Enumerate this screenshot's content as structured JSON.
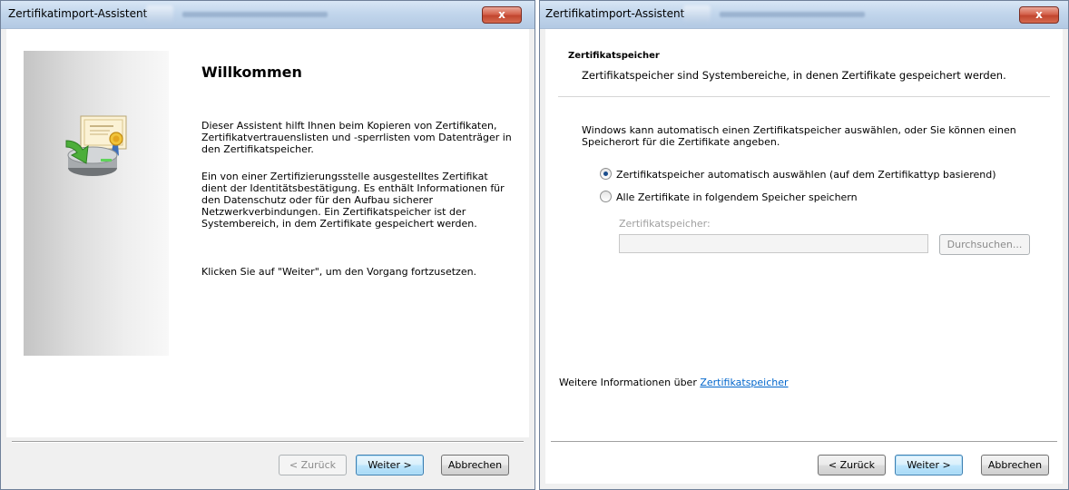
{
  "wizard_intro": {
    "title": "Zertifikatimport-Assistent",
    "close_glyph": "x",
    "heading": "Willkommen",
    "paragraph1": "Dieser Assistent hilft Ihnen beim Kopieren von Zertifikaten, Zertifikatvertrauenslisten und -sperrlisten vom Datenträger in den Zertifikatspeicher.",
    "paragraph2": "Ein von einer Zertifizierungsstelle ausgestelltes Zertifikat dient der Identitätsbestätigung. Es enthält Informationen für den Datenschutz oder für den Aufbau sicherer Netzwerkverbindungen. Ein Zertifikatspeicher ist der Systembereich, in dem Zertifikate gespeichert werden.",
    "paragraph3": "Klicken Sie auf \"Weiter\", um den Vorgang fortzusetzen.",
    "icon": "certificate-import-icon",
    "buttons": {
      "back": "< Zurück",
      "next": "Weiter >",
      "cancel": "Abbrechen"
    }
  },
  "wizard_store": {
    "title": "Zertifikatimport-Assistent",
    "close_glyph": "x",
    "section_title": "Zertifikatspeicher",
    "section_subtitle": "Zertifikatspeicher sind Systembereiche, in denen Zertifikate gespeichert werden.",
    "description": "Windows kann automatisch einen Zertifikatspeicher auswählen, oder Sie können einen Speicherort für die Zertifikate angeben.",
    "options": [
      {
        "label": "Zertifikatspeicher automatisch auswählen (auf dem Zertifikattyp basierend)",
        "selected": true
      },
      {
        "label": "Alle Zertifikate in folgendem Speicher speichern",
        "selected": false
      }
    ],
    "store_field_label": "Zertifikatspeicher:",
    "store_field_value": "",
    "browse_label": "Durchsuchen...",
    "more_info_text": "Weitere Informationen über ",
    "more_info_link": "Zertifikatspeicher",
    "buttons": {
      "back": "< Zurück",
      "next": "Weiter >",
      "cancel": "Abbrechen"
    }
  },
  "colors": {
    "link": "#0066cc",
    "close_button": "#c1452e",
    "title_bar": "#c2d6ec"
  }
}
